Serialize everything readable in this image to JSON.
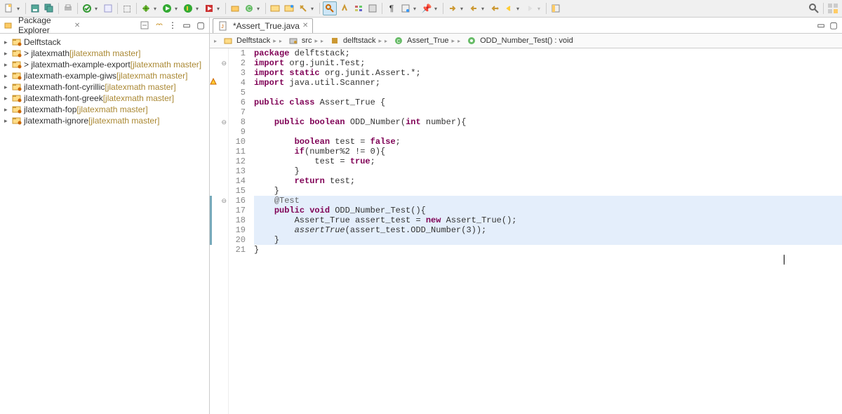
{
  "toolbar_icons": [
    "new-icon",
    "save-icon",
    "save-all-icon",
    "print-icon",
    "build-icon",
    "validate-icon",
    "run-icon",
    "terminal-icon",
    "debug-line-icon",
    "run-config-icon",
    "coverage-icon",
    "profile-icon",
    "new-pkg-icon",
    "new-class-icon",
    "open-type-icon",
    "open-task-icon",
    "search-menu-icon",
    "annotation-icon",
    "highlight-icon",
    "toggle-breadcrumb-icon",
    "toggle-mark-icon",
    "pin-icon",
    "pi-icon",
    "nav-menu-icon",
    "nav-menu2-icon",
    "back-icon",
    "forward-icon",
    "prev-edit-icon",
    "next-edit-icon",
    "fwd2-icon",
    "perspective-icon"
  ],
  "search_icon_label": "Search",
  "pkg": {
    "title": "Package Explorer",
    "tree": [
      {
        "icon": "project",
        "label": "Delftstack",
        "repo": ""
      },
      {
        "icon": "project",
        "label": "> jlatexmath",
        "repo": "[jlatexmath master]"
      },
      {
        "icon": "project",
        "label": "> jlatexmath-example-export",
        "repo": "[jlatexmath master]"
      },
      {
        "icon": "project",
        "label": "jlatexmath-example-giws",
        "repo": "[jlatexmath master]"
      },
      {
        "icon": "project",
        "label": "jlatexmath-font-cyrillic",
        "repo": "[jlatexmath master]"
      },
      {
        "icon": "project",
        "label": "jlatexmath-font-greek",
        "repo": "[jlatexmath master]"
      },
      {
        "icon": "project",
        "label": "jlatexmath-fop",
        "repo": "[jlatexmath master]"
      },
      {
        "icon": "project",
        "label": "jlatexmath-ignore",
        "repo": "[jlatexmath master]"
      }
    ]
  },
  "editor": {
    "tab_label": "*Assert_True.java",
    "breadcrumb": [
      {
        "icon": "project",
        "label": "Delftstack"
      },
      {
        "icon": "srcfolder",
        "label": "src"
      },
      {
        "icon": "package",
        "label": "delftstack"
      },
      {
        "icon": "class",
        "label": "Assert_True"
      },
      {
        "icon": "method",
        "label": "ODD_Number_Test() : void"
      }
    ],
    "lines": [
      {
        "n": 1,
        "g": "",
        "html": "<span class='kw'>package</span> delftstack;"
      },
      {
        "n": 2,
        "g": "fold",
        "html": "<span class='kw'>import</span> org.junit.Test;"
      },
      {
        "n": 3,
        "g": "",
        "html": "<span class='kw'>import static</span> org.junit.Assert.*;"
      },
      {
        "n": 4,
        "g": "warn",
        "html": "<span class='kw'>import</span> java.util.Scanner;"
      },
      {
        "n": 5,
        "g": "",
        "html": ""
      },
      {
        "n": 6,
        "g": "",
        "html": "<span class='kw'>public class</span> Assert_True {"
      },
      {
        "n": 7,
        "g": "",
        "html": ""
      },
      {
        "n": 8,
        "g": "fold",
        "html": "    <span class='kw'>public boolean</span> ODD_Number(<span class='kw'>int</span> number){"
      },
      {
        "n": 9,
        "g": "",
        "html": ""
      },
      {
        "n": 10,
        "g": "",
        "html": "        <span class='kw'>boolean</span> test = <span class='kw'>false</span>;"
      },
      {
        "n": 11,
        "g": "",
        "html": "        <span class='kw'>if</span>(number%2 != 0){"
      },
      {
        "n": 12,
        "g": "",
        "html": "            test = <span class='kw'>true</span>;"
      },
      {
        "n": 13,
        "g": "",
        "html": "        }"
      },
      {
        "n": 14,
        "g": "",
        "html": "        <span class='kw'>return</span> test;"
      },
      {
        "n": 15,
        "g": "",
        "html": "    }"
      },
      {
        "n": 16,
        "g": "fold",
        "hl": true,
        "html": "    <span class='ann'>@Test</span>"
      },
      {
        "n": 17,
        "g": "",
        "hl": true,
        "html": "    <span class='kw'>public void</span> ODD_Number_Test(){"
      },
      {
        "n": 18,
        "g": "",
        "hl": true,
        "html": "        Assert_True assert_test = <span class='kw'>new</span> Assert_True();"
      },
      {
        "n": 19,
        "g": "",
        "hl": true,
        "html": "        <span style='font-style:italic'>assertTrue</span>(assert_test.ODD_Number(3));"
      },
      {
        "n": 20,
        "g": "",
        "hl": true,
        "html": "    }"
      },
      {
        "n": 21,
        "g": "",
        "html": "}"
      }
    ]
  }
}
